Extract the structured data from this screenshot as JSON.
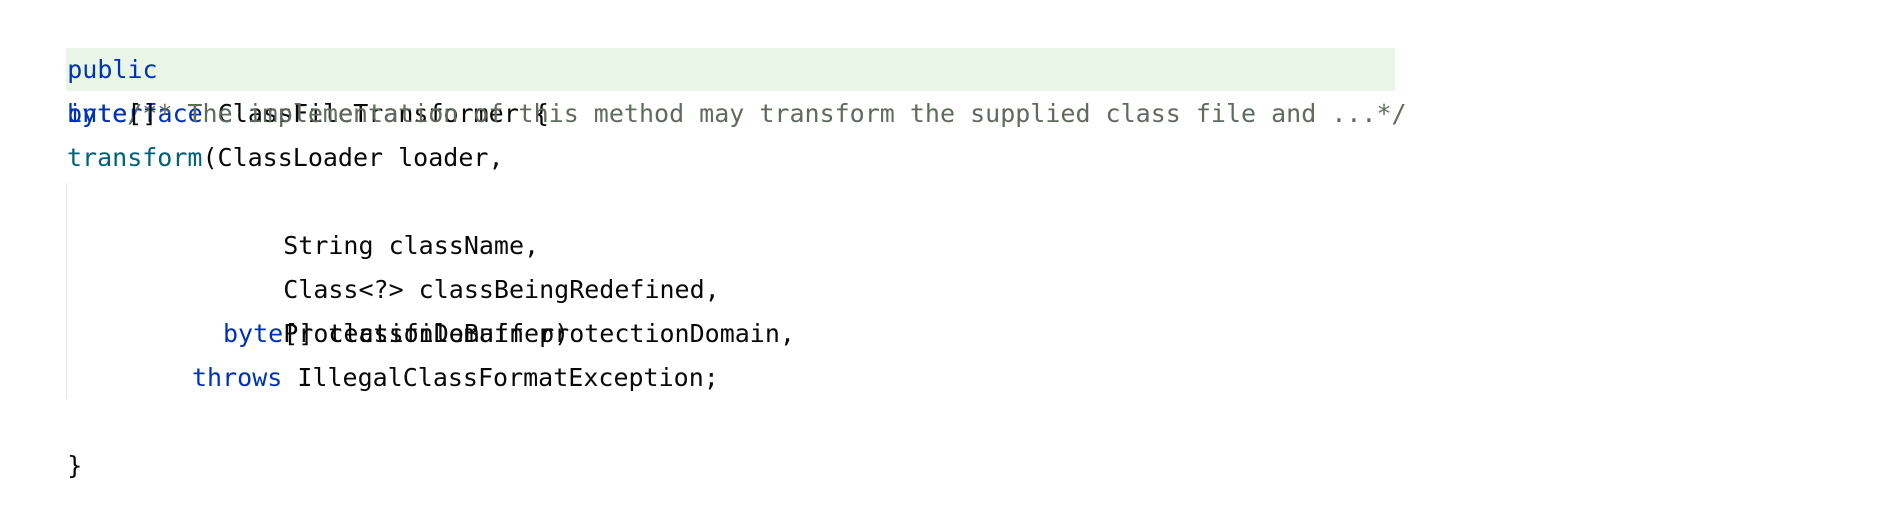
{
  "code": {
    "line1": {
      "kw_public": "public",
      "kw_interface": "interface",
      "rest": " ClassFileTransformer {"
    },
    "line2": {
      "comment": "/** The implementation of this method may transform the supplied class file and ...*/"
    },
    "line3": {
      "kw_byte": "byte",
      "rest": "[]"
    },
    "line4": {
      "method": "transform",
      "rest": "(ClassLoader loader,"
    },
    "line5": {
      "text": "String className,"
    },
    "line6": {
      "text": "Class<?> classBeingRedefined,"
    },
    "line7": {
      "text": "ProtectionDomain protectionDomain,"
    },
    "line8": {
      "kw_byte": "byte",
      "rest": "[] classfileBuffer)"
    },
    "line9": {
      "kw_throws": "throws",
      "rest": " IllegalClassFormatException;"
    },
    "line10": {
      "text": "}"
    }
  },
  "colors": {
    "keyword": "#0033b3",
    "method": "#00627a",
    "comment": "#5f6b5f",
    "comment_background": "#e9f5e6",
    "text": "#080808",
    "background": "#ffffff"
  }
}
